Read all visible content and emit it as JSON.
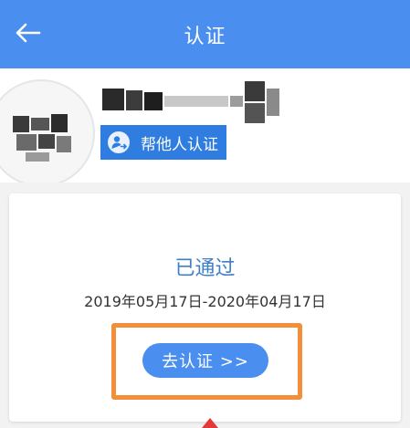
{
  "header": {
    "title": "认证",
    "back_icon": "arrow-left-icon"
  },
  "profile": {
    "help_button_label": "帮他人认证",
    "help_icon": "user-swap-icon"
  },
  "certification": {
    "status": "已通过",
    "date_range": "2019年05月17日-2020年04月17日",
    "action_label": "去认证 >>"
  },
  "colors": {
    "header_bg": "#4a8ef0",
    "button_bg": "#4a8ef0",
    "help_button_bg": "#2f7de1",
    "status_text": "#3f7ec9",
    "highlight_border": "#f28f3b"
  }
}
